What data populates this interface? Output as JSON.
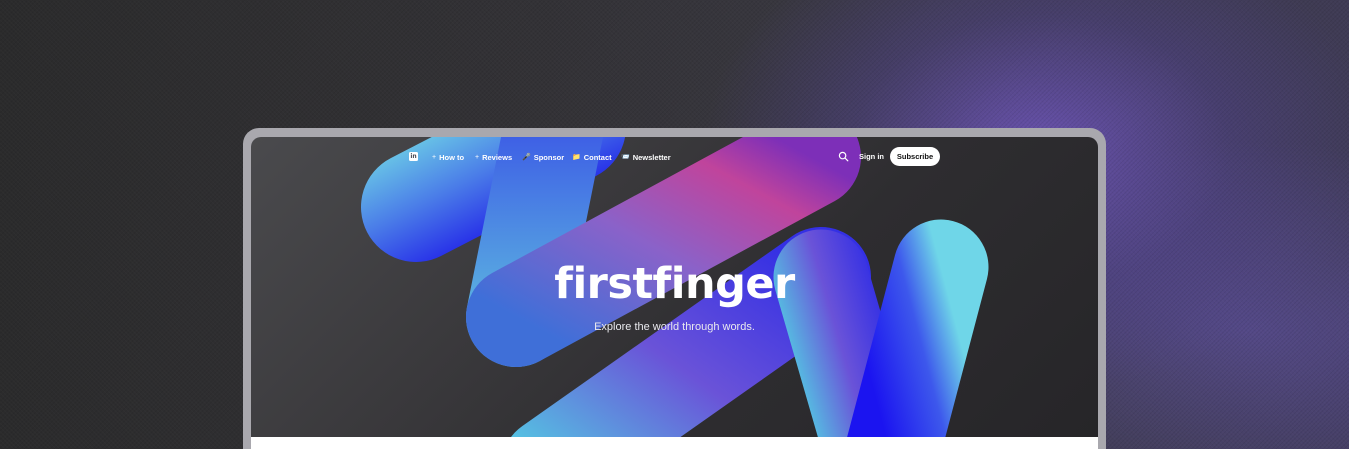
{
  "site": {
    "title": "firstfinger",
    "tagline": "Explore the world through words."
  },
  "nav": {
    "linkedin_icon": "linkedin-icon",
    "items": [
      {
        "emoji": "+",
        "label": "How to"
      },
      {
        "emoji": "+",
        "label": "Reviews"
      },
      {
        "emoji": "🎤",
        "label": "Sponsor"
      },
      {
        "emoji": "📁",
        "label": "Contact"
      },
      {
        "emoji": "📨",
        "label": "Newsletter"
      }
    ],
    "search_icon": "search-icon",
    "signin_label": "Sign in",
    "subscribe_label": "Subscribe"
  },
  "colors": {
    "accent_blue": "#2b3cf0",
    "accent_cyan": "#55c7e6",
    "accent_magenta": "#c0449c",
    "device_frame": "#a9a8ae"
  }
}
